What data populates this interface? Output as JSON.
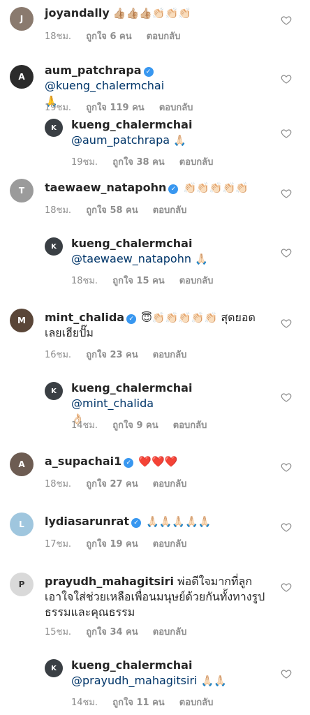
{
  "time_unit": "ชม.",
  "comments": [
    {
      "username": "joyandally",
      "verified": false,
      "text": "",
      "emoji": "👍🏼👍🏼👍🏼👏🏻👏🏻👏🏻",
      "time": "18ชม.",
      "likes": "ถูกใจ 6 คน",
      "reply": "ตอบกลับ"
    },
    {
      "username": "aum_patchrapa",
      "verified": true,
      "mention": "@kueng_chalermchai",
      "emoji": "🙏",
      "time": "19ชม.",
      "likes": "ถูกใจ 119 คน",
      "reply": "ตอบกลับ"
    },
    {
      "username": "kueng_chalermchai",
      "verified": false,
      "mention": "@aum_patchrapa",
      "emoji": "🙏🏻",
      "time": "19ชม.",
      "likes": "ถูกใจ 38 คน",
      "reply": "ตอบกลับ"
    },
    {
      "username": "taewaew_natapohn",
      "verified": true,
      "emoji": "👏🏻👏🏻👏🏻👏🏻👏🏻",
      "time": "18ชม.",
      "likes": "ถูกใจ 58 คน",
      "reply": "ตอบกลับ"
    },
    {
      "username": "kueng_chalermchai",
      "verified": false,
      "mention": "@taewaew_natapohn",
      "emoji": "🙏🏻",
      "time": "18ชม.",
      "likes": "ถูกใจ 15 คน",
      "reply": "ตอบกลับ"
    },
    {
      "username": "mint_chalida",
      "verified": true,
      "emoji": "😇👏🏻👏🏻👏🏻👏🏻👏🏻",
      "text": "สุดยอดเลยเฮียปั๊ม",
      "time": "16ชม.",
      "likes": "ถูกใจ 23 คน",
      "reply": "ตอบกลับ"
    },
    {
      "username": "kueng_chalermchai",
      "verified": false,
      "mention": "@mint_chalida",
      "emoji": "👌🏻",
      "time": "14ชม.",
      "likes": "ถูกใจ 9 คน",
      "reply": "ตอบกลับ"
    },
    {
      "username": "a_supachai1",
      "verified": true,
      "emoji": "❤️❤️❤️",
      "time": "18ชม.",
      "likes": "ถูกใจ 27 คน",
      "reply": "ตอบกลับ"
    },
    {
      "username": "lydiasarunrat",
      "verified": true,
      "emoji": "🙏🏻🙏🏻🙏🏻🙏🏻🙏🏻",
      "time": "17ชม.",
      "likes": "ถูกใจ 19 คน",
      "reply": "ตอบกลับ"
    },
    {
      "username": "prayudh_mahagitsiri",
      "verified": false,
      "text": "พ่อดีใจมากที่ลูกเอาใจใส่ช่วยเหลือเพื่อนมนุษย์ด้วยกันทั้งทางรูปธรรมและคุณธรรม",
      "time": "15ชม.",
      "likes": "ถูกใจ 34 คน",
      "reply": "ตอบกลับ"
    },
    {
      "username": "kueng_chalermchai",
      "verified": false,
      "mention": "@prayudh_mahagitsiri",
      "emoji": "🙏🏻🙏🏻",
      "time": "14ชม.",
      "likes": "ถูกใจ 11 คน",
      "reply": "ตอบกลับ"
    }
  ],
  "avatar_colors": {
    "joyandally": "#8a7a6e",
    "aum_patchrapa": "#2b2b2b",
    "kueng_chalermchai": "#3a3f44",
    "taewaew_natapohn": "#9b9b9b",
    "mint_chalida": "#5a4638",
    "a_supachai1": "#6d5c52",
    "lydiasarunrat": "#9fc6de",
    "prayudh_mahagitsiri": "#d9d9d9"
  },
  "icons": {
    "like": "heart-outline-icon",
    "verified": "verified-badge-icon"
  }
}
